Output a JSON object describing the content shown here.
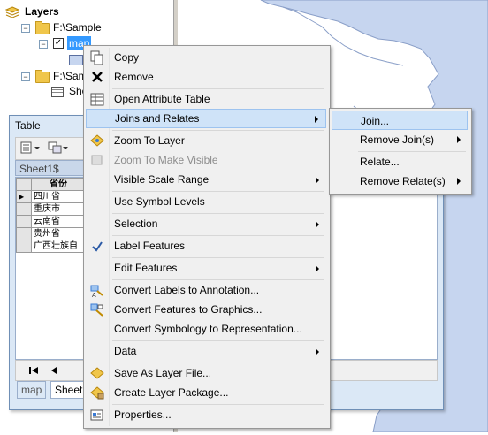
{
  "toc": {
    "title": "Layers",
    "sources": [
      "F:\\Sample",
      "F:\\Sam"
    ],
    "layer_name": "map",
    "table_item": "She"
  },
  "table": {
    "title": "Table",
    "name": "Sheet1$",
    "column_header": "省份",
    "rows": [
      "四川省",
      "重庆市",
      "云南省",
      "贵州省",
      "广西壮族自"
    ],
    "tabs": [
      "map",
      "Sheet1"
    ]
  },
  "context_menu": {
    "items": [
      {
        "label": "Copy",
        "icon": "copy-icon"
      },
      {
        "label": "Remove",
        "icon": "remove-icon"
      },
      {
        "label": "Open Attribute Table",
        "icon": "table-icon"
      },
      {
        "label": "Joins and Relates",
        "icon": ""
      },
      {
        "label": "Zoom To Layer",
        "icon": "zoom-layer-icon"
      },
      {
        "label": "Zoom To Make Visible",
        "icon": "zoom-visible-icon"
      },
      {
        "label": "Visible Scale Range",
        "icon": ""
      },
      {
        "label": "Use Symbol Levels",
        "icon": ""
      },
      {
        "label": "Selection",
        "icon": ""
      },
      {
        "label": "Label Features",
        "icon": "check-icon"
      },
      {
        "label": "Edit Features",
        "icon": ""
      },
      {
        "label": "Convert Labels to Annotation...",
        "icon": "convert-labels-icon"
      },
      {
        "label": "Convert Features to Graphics...",
        "icon": "convert-features-icon"
      },
      {
        "label": "Convert Symbology to Representation...",
        "icon": ""
      },
      {
        "label": "Data",
        "icon": ""
      },
      {
        "label": "Save As Layer File...",
        "icon": "layer-file-icon"
      },
      {
        "label": "Create Layer Package...",
        "icon": "layer-package-icon"
      },
      {
        "label": "Properties...",
        "icon": "properties-icon"
      }
    ]
  },
  "sub_menu": {
    "items": [
      {
        "label": "Join..."
      },
      {
        "label": "Remove Join(s)"
      },
      {
        "label": "Relate..."
      },
      {
        "label": "Remove Relate(s)"
      }
    ]
  },
  "colors": {
    "map_region": "#c6d5ef",
    "map_border": "#8a9fc8",
    "menu_bg": "#f0f0f0",
    "highlight": "#cfe3f8",
    "highlight_border": "#9dc3ef",
    "selected_layer": "#3399ff"
  }
}
